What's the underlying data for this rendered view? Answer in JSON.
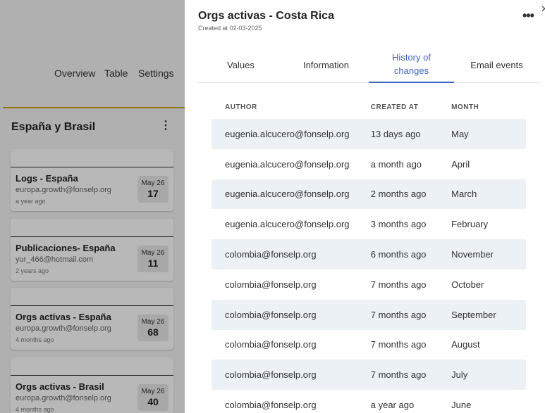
{
  "background": {
    "nav": {
      "overview": "Overview",
      "table": "Table",
      "settings": "Settings"
    },
    "section_title": "España y Brasil",
    "section_menu_icon": "kebab-vertical-icon",
    "accent_rule_color": "#c9a416",
    "cards": [
      {
        "name": "Logs - España",
        "email": "europa.growth@fonselp.org",
        "age": "a year ago",
        "month": "May 26",
        "count": "17"
      },
      {
        "name": "Publicaciones- España",
        "email": "yur_466@hotmail.com",
        "age": "2 years ago",
        "month": "May 26",
        "count": "11"
      },
      {
        "name": "Orgs activas - España",
        "email": "europa.growth@fonselp.org",
        "age": "4 months ago",
        "month": "May 26",
        "count": "68"
      },
      {
        "name": "Orgs activas - Brasil",
        "email": "europa.growth@fonselp.org",
        "age": "4 months ago",
        "month": "May 26",
        "count": "40"
      }
    ]
  },
  "panel": {
    "title": "Orgs activas - Costa Rica",
    "created": "Created at 02-03-2025",
    "more_icon": "more-horizontal-icon",
    "close_icon": "close-icon",
    "close_glyph": "✕",
    "tabs": [
      {
        "label": "Values",
        "active": false
      },
      {
        "label": "Information",
        "active": false
      },
      {
        "label": "History of changes",
        "active": true
      },
      {
        "label": "Email events",
        "active": false
      }
    ],
    "accent_color": "#3f63c4",
    "row_shade_color": "#ecf1f6",
    "history": {
      "columns": [
        "AUTHOR",
        "CREATED AT",
        "MONTH"
      ],
      "rows": [
        {
          "author": "eugenia.alcucero@fonselp.org",
          "created": "13 days ago",
          "month": "May"
        },
        {
          "author": "eugenia.alcucero@fonselp.org",
          "created": "a month ago",
          "month": "April"
        },
        {
          "author": "eugenia.alcucero@fonselp.org",
          "created": "2 months ago",
          "month": "March"
        },
        {
          "author": "eugenia.alcucero@fonselp.org",
          "created": "3 months ago",
          "month": "February"
        },
        {
          "author": "colombia@fonselp.org",
          "created": "6 months ago",
          "month": "November"
        },
        {
          "author": "colombia@fonselp.org",
          "created": "7 months ago",
          "month": "October"
        },
        {
          "author": "colombia@fonselp.org",
          "created": "7 months ago",
          "month": "September"
        },
        {
          "author": "colombia@fonselp.org",
          "created": "7 months ago",
          "month": "August"
        },
        {
          "author": "colombia@fonselp.org",
          "created": "7 months ago",
          "month": "July"
        },
        {
          "author": "colombia@fonselp.org",
          "created": "a year ago",
          "month": "June"
        }
      ]
    }
  }
}
